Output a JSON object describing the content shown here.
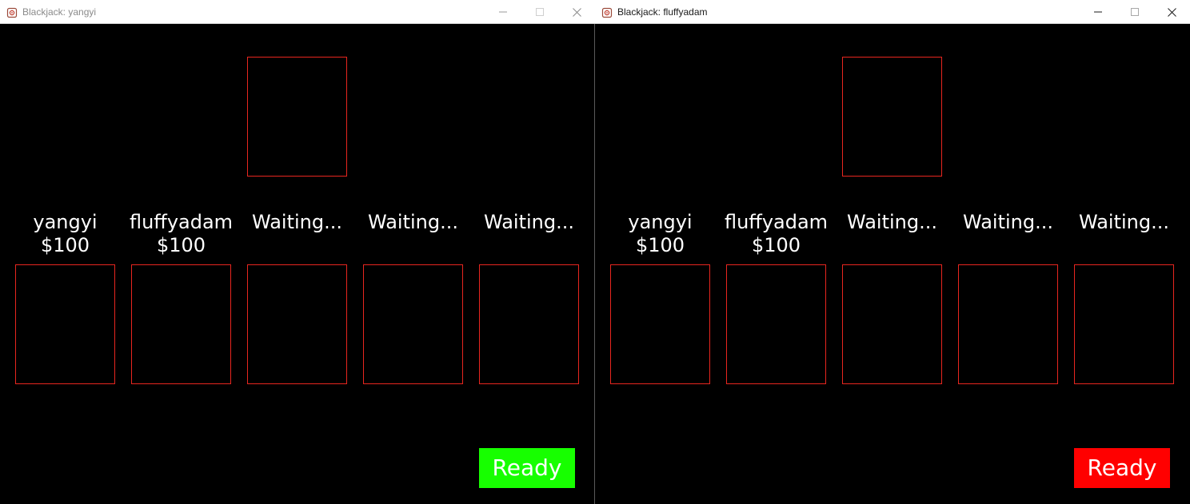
{
  "windows": [
    {
      "title": "Blackjack: yangyi",
      "active": false,
      "players": [
        {
          "name": "yangyi",
          "money": "$100"
        },
        {
          "name": "fluffyadam",
          "money": "$100"
        },
        {
          "name": "Waiting...",
          "money": ""
        },
        {
          "name": "Waiting...",
          "money": ""
        },
        {
          "name": "Waiting...",
          "money": ""
        }
      ],
      "ready_button": {
        "label": "Ready",
        "color": "#17ff00"
      }
    },
    {
      "title": "Blackjack: fluffyadam",
      "active": true,
      "players": [
        {
          "name": "yangyi",
          "money": "$100"
        },
        {
          "name": "fluffyadam",
          "money": "$100"
        },
        {
          "name": "Waiting...",
          "money": ""
        },
        {
          "name": "Waiting...",
          "money": ""
        },
        {
          "name": "Waiting...",
          "money": ""
        }
      ],
      "ready_button": {
        "label": "Ready",
        "color": "#ff0000"
      }
    }
  ],
  "colors": {
    "slot_border": "#e8261f",
    "background": "#000000",
    "text": "#ffffff"
  },
  "icons": {
    "app": "blackjack-app-icon",
    "minimize": "minimize-icon",
    "maximize": "maximize-icon",
    "close": "close-icon"
  }
}
